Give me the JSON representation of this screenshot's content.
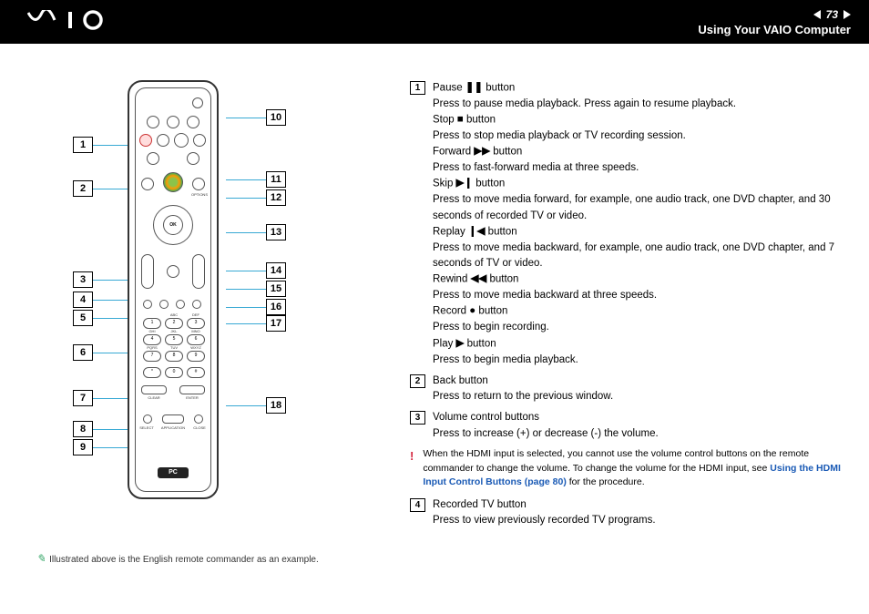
{
  "header": {
    "logo_text": "VAIO",
    "page_number": "73",
    "section": "Using Your VAIO Computer"
  },
  "remote": {
    "caption_prefix": "✍",
    "caption": "Illustrated above is the English remote commander as an example.",
    "pc_label": "PC",
    "ok_label": "OK",
    "options_label": "OPTIONS",
    "select_label": "SELECT",
    "application_label": "APPLICATION",
    "close_label": "CLOSE",
    "enter_label": "ENTER",
    "clear_label": "CLEAR",
    "callouts_left": [
      "1",
      "2",
      "3",
      "4",
      "5",
      "6",
      "7",
      "8",
      "9"
    ],
    "callouts_right": [
      "10",
      "11",
      "12",
      "13",
      "14",
      "15",
      "16",
      "17",
      "18"
    ],
    "keypad_labels": [
      "ABC",
      "DEF",
      "GHI",
      "JKL",
      "MNO",
      "PQRS",
      "TUV",
      "WXYZ"
    ],
    "keypad_nums": [
      "1",
      "2",
      "3",
      "4",
      "5",
      "6",
      "7",
      "8",
      "9",
      "*",
      "0",
      "#"
    ]
  },
  "descriptions": [
    {
      "num": "1",
      "lines": [
        {
          "label": "Pause",
          "sym": "❚❚",
          "suffix": " button"
        },
        {
          "text": "Press to pause media playback. Press again to resume playback."
        },
        {
          "label": "Stop",
          "sym": "■",
          "suffix": " button"
        },
        {
          "text": "Press to stop media playback or TV recording session."
        },
        {
          "label": "Forward",
          "sym": "▶▶",
          "suffix": " button"
        },
        {
          "text": "Press to fast-forward media at three speeds."
        },
        {
          "label": "Skip",
          "sym": "▶❙",
          "suffix": " button"
        },
        {
          "text": "Press to move media forward, for example, one audio track, one DVD chapter, and 30 seconds of recorded TV or video."
        },
        {
          "label": "Replay",
          "sym": "❙◀",
          "suffix": " button"
        },
        {
          "text": "Press to move media backward, for example, one audio track, one DVD chapter, and 7 seconds of TV or video."
        },
        {
          "label": "Rewind",
          "sym": "◀◀",
          "suffix": " button"
        },
        {
          "text": "Press to move media backward at three speeds."
        },
        {
          "label": "Record",
          "sym": "●",
          "suffix": " button"
        },
        {
          "text": "Press to begin recording."
        },
        {
          "label": "Play",
          "sym": "▶",
          "suffix": " button"
        },
        {
          "text": "Press to begin media playback."
        }
      ]
    },
    {
      "num": "2",
      "lines": [
        {
          "label": "Back button",
          "sym": "",
          "suffix": ""
        },
        {
          "text": "Press to return to the previous window."
        }
      ]
    },
    {
      "num": "3",
      "lines": [
        {
          "label": "Volume control buttons",
          "sym": "",
          "suffix": ""
        },
        {
          "text": "Press to increase (+) or decrease (-) the volume."
        }
      ]
    }
  ],
  "warning": {
    "icon": "!",
    "text_before": "When the HDMI input is selected, you cannot use the volume control buttons on the remote commander to change the volume. To change the volume for the HDMI input, see ",
    "link": "Using the HDMI Input Control Buttons (page 80)",
    "text_after": " for the procedure."
  },
  "desc4": {
    "num": "4",
    "title": "Recorded TV button",
    "text": "Press to view previously recorded TV programs."
  }
}
